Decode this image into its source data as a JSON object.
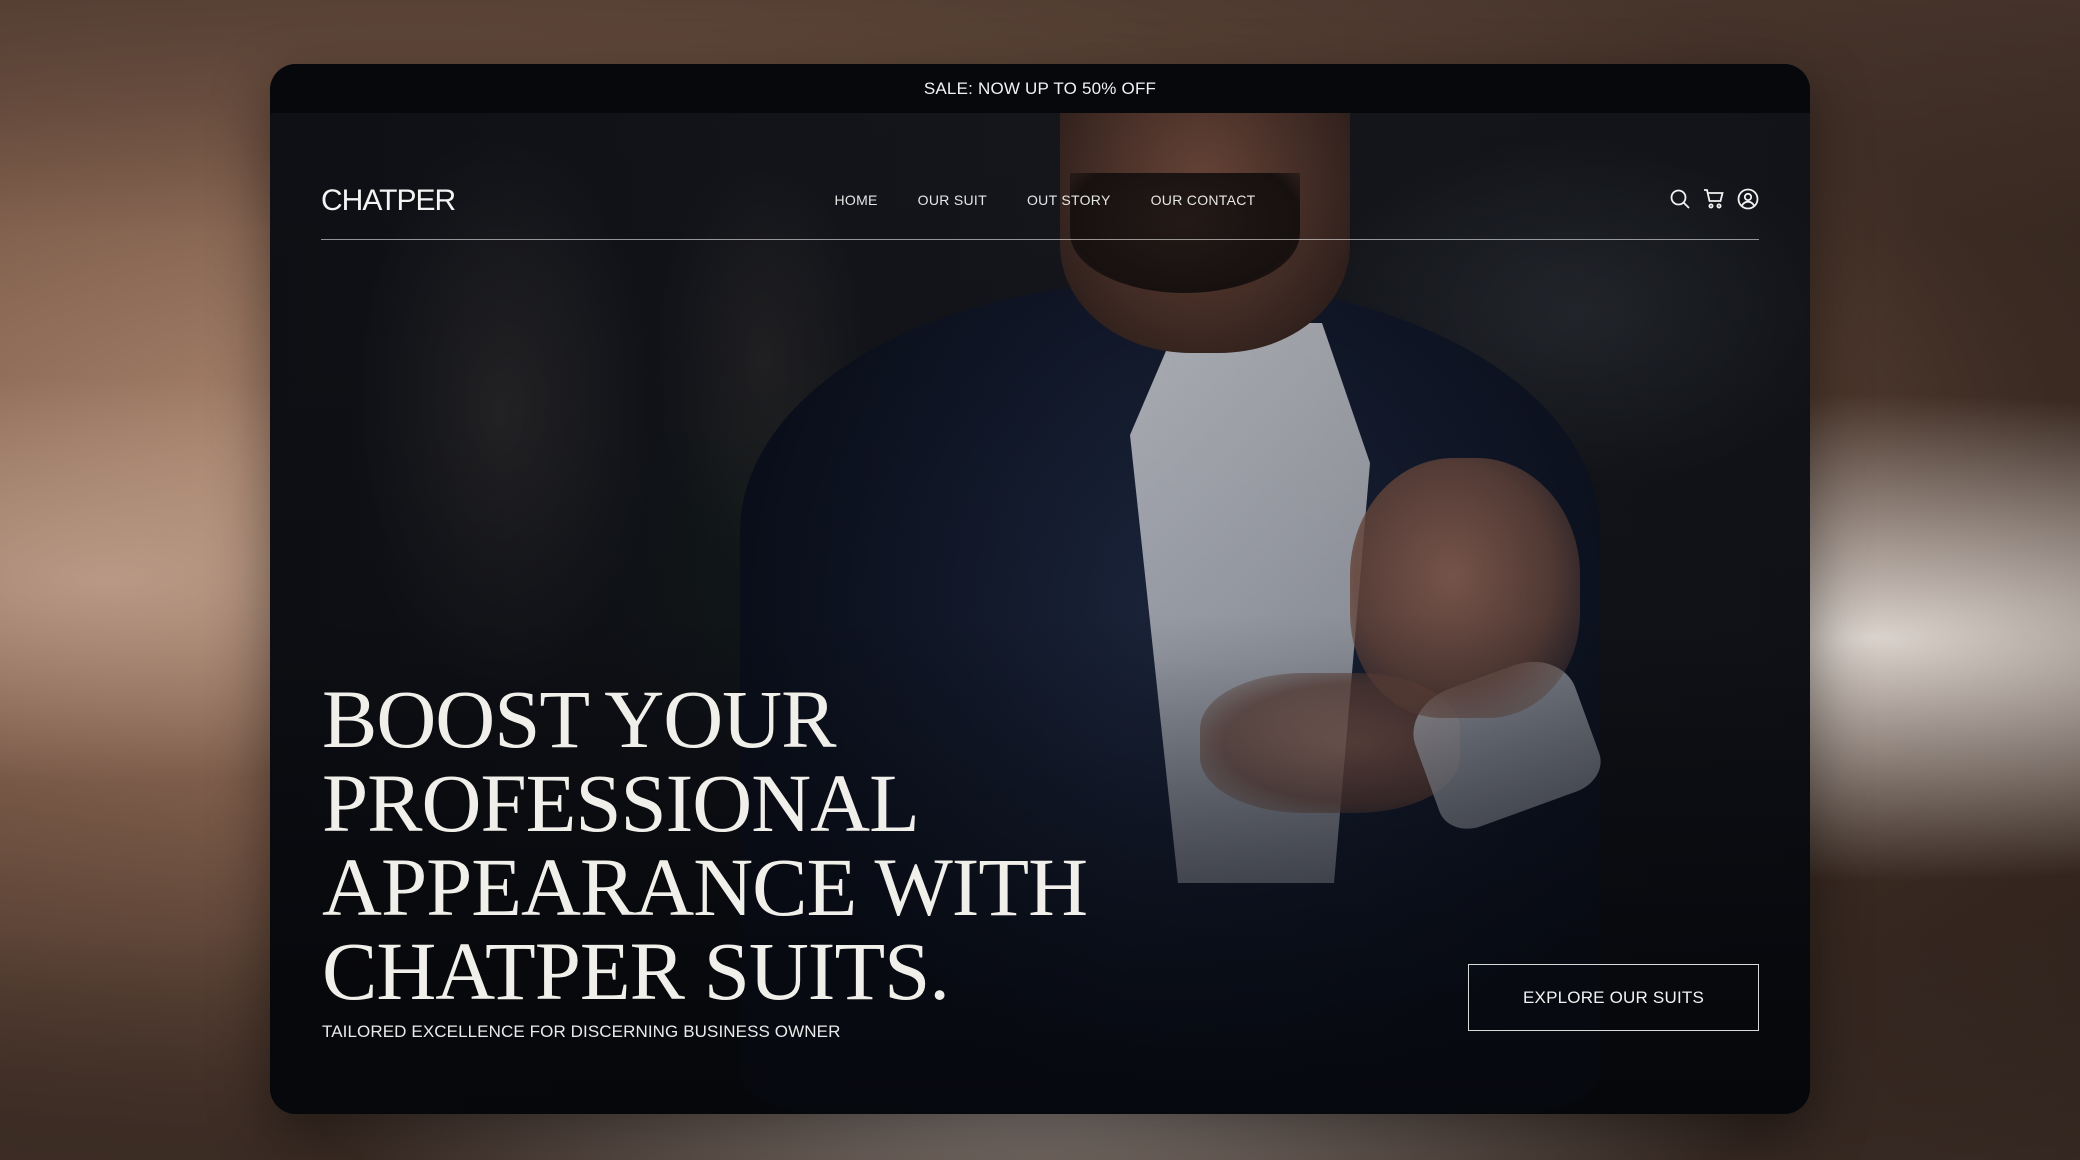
{
  "promo": {
    "text": "SALE: NOW UP TO 50% OFF"
  },
  "brand": {
    "logo": "CHATPER"
  },
  "nav": {
    "links": [
      "HOME",
      "OUR SUIT",
      "OUT STORY",
      "OUR CONTACT"
    ],
    "icons": [
      "search-icon",
      "cart-icon",
      "account-icon"
    ]
  },
  "hero": {
    "headline_lines": [
      "BOOST YOUR",
      "PROFESSIONAL",
      "APPEARANCE WITH",
      "CHATPER SUITS."
    ],
    "subtitle": "TAILORED EXCELLENCE FOR DISCERNING BUSINESS OWNER",
    "cta_label": "EXPLORE OUR SUITS"
  },
  "colors": {
    "text": "#f1efea",
    "background": "#0b0d12",
    "accent": "#ffffff"
  }
}
